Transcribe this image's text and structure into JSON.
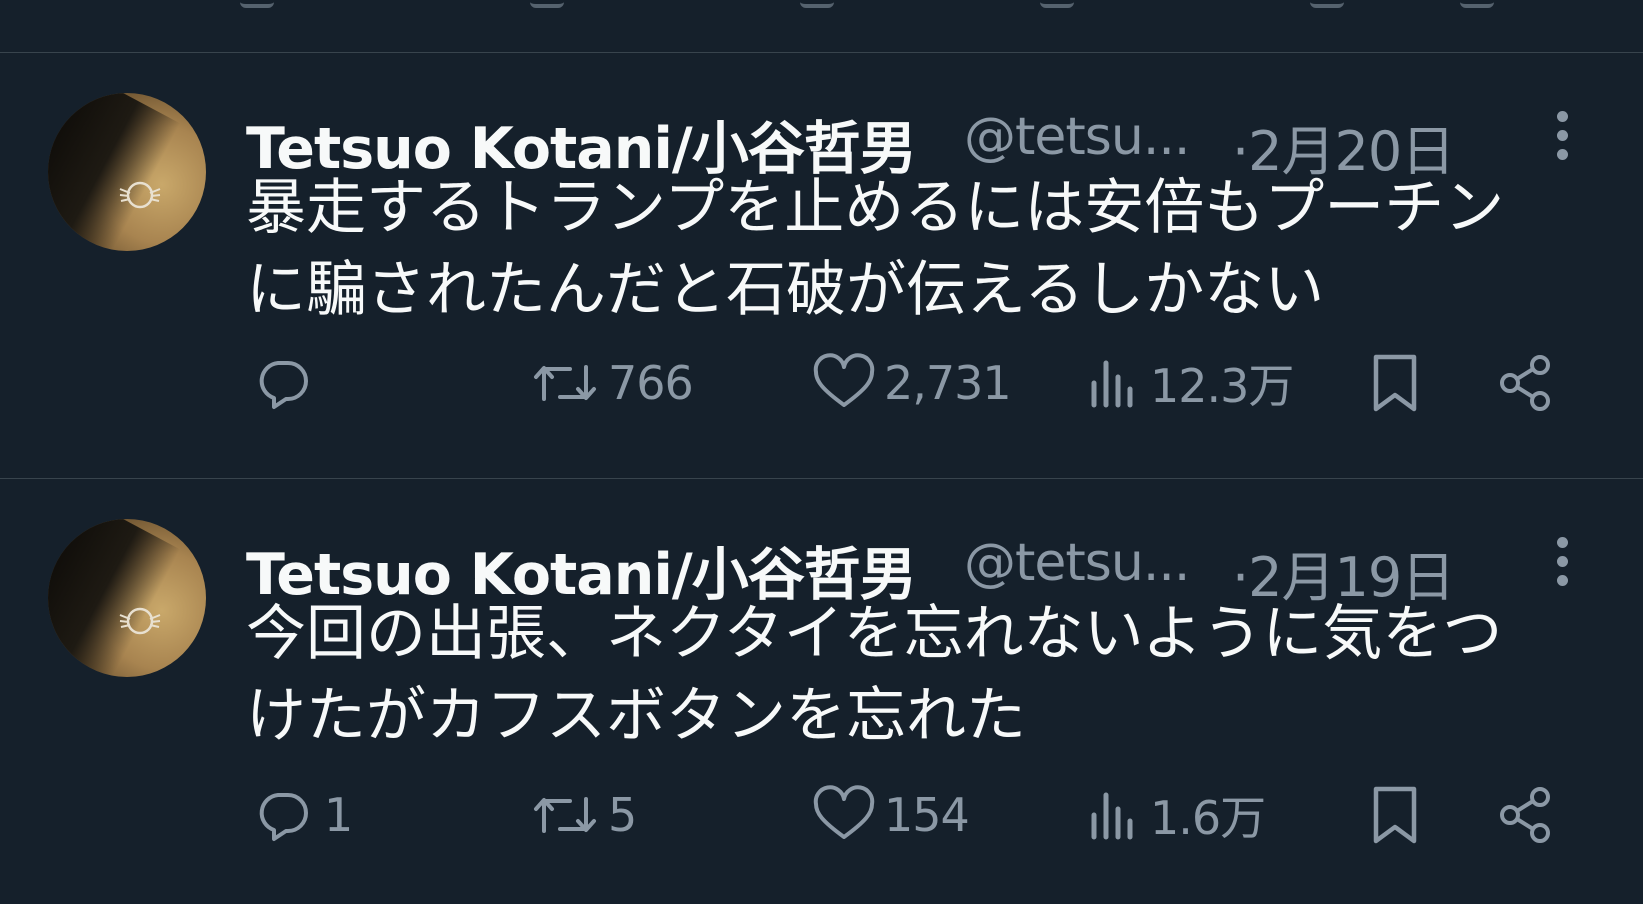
{
  "colors": {
    "background": "#15202b",
    "divider": "#38444d",
    "text_primary": "#f7f9f9",
    "text_secondary": "#8b98a5"
  },
  "tweets": [
    {
      "author_name": "Tetsuo Kotani/小谷哲男",
      "handle": "@tetsu...",
      "date": "·2月20日",
      "text_lines": [
        "暴走するトランプを止めるには安倍もプーチン",
        "に騙されたんだと石破が伝えるしかない"
      ],
      "actions": {
        "reply_icon": "reply-icon",
        "replies": "",
        "retweet_icon": "retweet-icon",
        "retweets": "766",
        "like_icon": "heart-icon",
        "likes": "2,731",
        "views_icon": "views-icon",
        "views": "12.3万",
        "bookmark_icon": "bookmark-icon",
        "share_icon": "share-icon"
      }
    },
    {
      "author_name": "Tetsuo Kotani/小谷哲男",
      "handle": "@tetsu...",
      "date": "·2月19日",
      "text_lines": [
        "今回の出張、ネクタイを忘れないように気をつ",
        "けたがカフスボタンを忘れた"
      ],
      "actions": {
        "reply_icon": "reply-icon",
        "replies": "1",
        "retweet_icon": "retweet-icon",
        "retweets": "5",
        "like_icon": "heart-icon",
        "likes": "154",
        "views_icon": "views-icon",
        "views": "1.6万",
        "bookmark_icon": "bookmark-icon",
        "share_icon": "share-icon"
      }
    }
  ]
}
